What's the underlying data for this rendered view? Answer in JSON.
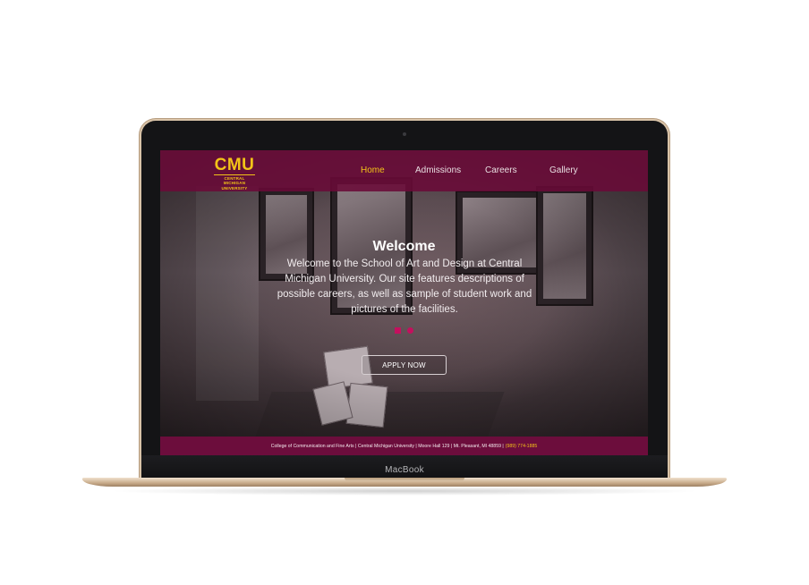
{
  "device": {
    "brand_label": "MacBook"
  },
  "nav": {
    "logo": {
      "mark": "CMU",
      "subtitle_line1": "CENTRAL MICHIGAN",
      "subtitle_line2": "UNIVERSITY"
    },
    "items": [
      {
        "label": "Home",
        "active": true
      },
      {
        "label": "Admissions",
        "active": false
      },
      {
        "label": "Careers",
        "active": false
      },
      {
        "label": "Gallery",
        "active": false
      }
    ]
  },
  "hero": {
    "title": "Welcome",
    "text": "Welcome to the School of Art and Design at Central Michigan University. Our site features descriptions of possible careers, as well as sample of student work and pictures of the facilities.",
    "cta_label": "APPLY NOW",
    "slides_count": 2,
    "active_slide": 1
  },
  "footer": {
    "address": "College of Communication and Fine Arts | Central Michigan University | Moore Hall 129 | Mt. Pleasant, MI 48859 |",
    "phone": "(989) 774-1885"
  },
  "colors": {
    "brand_maroon": "#6a0a38",
    "brand_gold": "#f2c318",
    "dot_accent": "#c4105e",
    "laptop_gold": "#d9c3a8"
  }
}
